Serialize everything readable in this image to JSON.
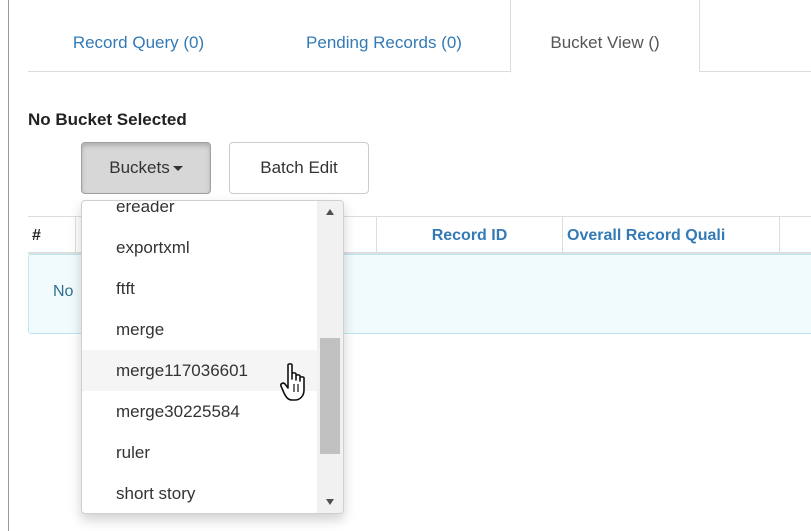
{
  "tabs": [
    {
      "label": "Record Query (0)"
    },
    {
      "label": "Pending Records (0)"
    },
    {
      "label": "Bucket View ()"
    }
  ],
  "heading": "No Bucket Selected",
  "buttons": {
    "buckets": "Buckets",
    "batch_edit": "Batch Edit"
  },
  "table": {
    "columns": [
      "#",
      "Record ID",
      "Overall Record Quali"
    ],
    "empty_text": "No"
  },
  "dropdown": {
    "items": [
      "ereader",
      "exportxml",
      "ftft",
      "merge",
      "merge117036601",
      "merge30225584",
      "ruler",
      "short story"
    ],
    "hovered": "merge117036601"
  },
  "icons": {
    "caret": "caret-down-icon",
    "cursor": "hand-pointer-icon"
  }
}
